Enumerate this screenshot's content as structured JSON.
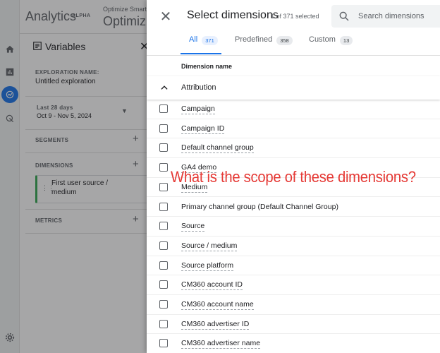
{
  "app": {
    "name": "Analytics",
    "badge": "ALPHA",
    "account_small": "Optimize Smart l",
    "account_big": "Optimiz"
  },
  "sidebar": {
    "items": [
      {
        "icon": "home-icon"
      },
      {
        "icon": "reports-icon"
      },
      {
        "icon": "explore-icon",
        "active": true
      },
      {
        "icon": "advertising-icon"
      },
      {
        "icon": "settings-icon"
      }
    ]
  },
  "variables_panel": {
    "title": "Variables",
    "exploration_name_label": "EXPLORATION NAME:",
    "exploration_name": "Untitled exploration",
    "date_range_label": "Last 28 days",
    "date_range": "Oct 9 - Nov 5, 2024",
    "segments_label": "SEGMENTS",
    "dimensions_label": "DIMENSIONS",
    "dimension_chip": "First user source / medium",
    "metrics_label": "METRICS"
  },
  "dialog": {
    "title": "Select dimensions",
    "count_text": "1 of 371 selected",
    "search_placeholder": "Search dimensions",
    "tabs": [
      {
        "label": "All",
        "count": "371",
        "active": true
      },
      {
        "label": "Predefined",
        "count": "358",
        "active": false
      },
      {
        "label": "Custom",
        "count": "13",
        "active": false
      }
    ],
    "column_header": "Dimension name",
    "group": {
      "label": "Attribution",
      "expanded": true
    },
    "rows": [
      "Campaign",
      "Campaign ID",
      "Default channel group",
      "GA4 demo",
      "Medium",
      "Primary channel group (Default Channel Group)",
      "Source",
      "Source / medium",
      "Source platform",
      "CM360 account ID",
      "CM360 account name",
      "CM360 advertiser ID",
      "CM360 advertiser name"
    ]
  },
  "annotation": {
    "text": "What is the scope of these dimensions?",
    "color": "#e53935"
  },
  "colors": {
    "accent": "#1a73e8",
    "logo_orange": "#f9ab00",
    "logo_dark_orange": "#e37400"
  }
}
